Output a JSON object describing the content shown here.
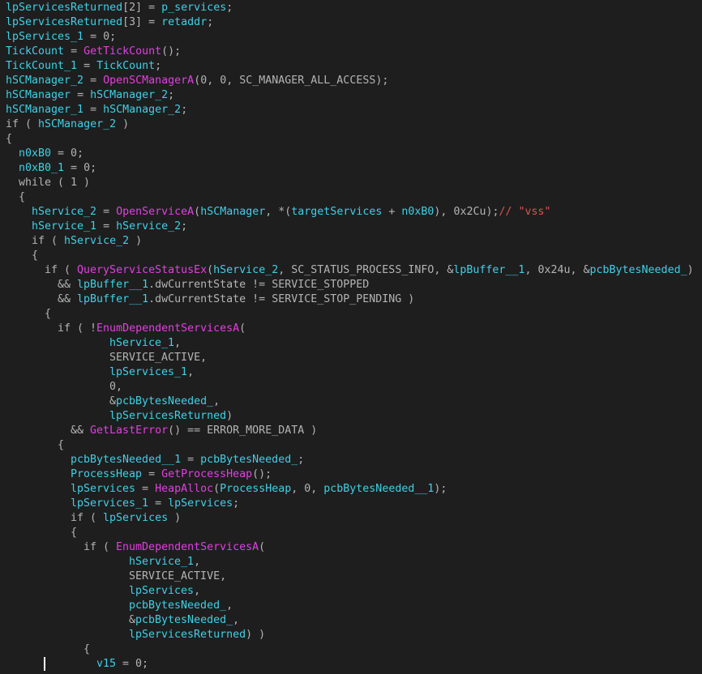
{
  "editor": {
    "lines": [
      {
        "indent": 0,
        "tokens": [
          {
            "t": "lpServicesReturned",
            "c": "var"
          },
          {
            "t": "[2] = ",
            "c": "txt"
          },
          {
            "t": "p_services",
            "c": "var"
          },
          {
            "t": ";",
            "c": "txt"
          }
        ]
      },
      {
        "indent": 0,
        "tokens": [
          {
            "t": "lpServicesReturned",
            "c": "var"
          },
          {
            "t": "[3] = ",
            "c": "txt"
          },
          {
            "t": "retaddr",
            "c": "var"
          },
          {
            "t": ";",
            "c": "txt"
          }
        ]
      },
      {
        "indent": 0,
        "tokens": [
          {
            "t": "lpServices_1",
            "c": "var"
          },
          {
            "t": " = 0;",
            "c": "txt"
          }
        ]
      },
      {
        "indent": 0,
        "tokens": [
          {
            "t": "TickCount",
            "c": "var"
          },
          {
            "t": " = ",
            "c": "txt"
          },
          {
            "t": "GetTickCount",
            "c": "func"
          },
          {
            "t": "();",
            "c": "txt"
          }
        ]
      },
      {
        "indent": 0,
        "tokens": [
          {
            "t": "TickCount_1",
            "c": "var"
          },
          {
            "t": " = ",
            "c": "txt"
          },
          {
            "t": "TickCount",
            "c": "var"
          },
          {
            "t": ";",
            "c": "txt"
          }
        ]
      },
      {
        "indent": 0,
        "tokens": [
          {
            "t": "hSCManager_2",
            "c": "var"
          },
          {
            "t": " = ",
            "c": "txt"
          },
          {
            "t": "OpenSCManagerA",
            "c": "func"
          },
          {
            "t": "(0, 0, SC_MANAGER_ALL_ACCESS);",
            "c": "txt"
          }
        ]
      },
      {
        "indent": 0,
        "tokens": [
          {
            "t": "hSCManager",
            "c": "var"
          },
          {
            "t": " = ",
            "c": "txt"
          },
          {
            "t": "hSCManager_2",
            "c": "var"
          },
          {
            "t": ";",
            "c": "txt"
          }
        ]
      },
      {
        "indent": 0,
        "tokens": [
          {
            "t": "hSCManager_1",
            "c": "var"
          },
          {
            "t": " = ",
            "c": "txt"
          },
          {
            "t": "hSCManager_2",
            "c": "var"
          },
          {
            "t": ";",
            "c": "txt"
          }
        ]
      },
      {
        "indent": 0,
        "tokens": [
          {
            "t": "if ( ",
            "c": "kw"
          },
          {
            "t": "hSCManager_2",
            "c": "var"
          },
          {
            "t": " )",
            "c": "txt"
          }
        ]
      },
      {
        "indent": 0,
        "tokens": [
          {
            "t": "{",
            "c": "txt"
          }
        ]
      },
      {
        "indent": 2,
        "tokens": [
          {
            "t": "n0xB0",
            "c": "var"
          },
          {
            "t": " = 0;",
            "c": "txt"
          }
        ]
      },
      {
        "indent": 2,
        "tokens": [
          {
            "t": "n0xB0_1",
            "c": "var"
          },
          {
            "t": " = 0;",
            "c": "txt"
          }
        ]
      },
      {
        "indent": 2,
        "tokens": [
          {
            "t": "while ( 1 )",
            "c": "kw"
          }
        ]
      },
      {
        "indent": 2,
        "tokens": [
          {
            "t": "{",
            "c": "txt"
          }
        ]
      },
      {
        "indent": 4,
        "tokens": [
          {
            "t": "hService_2",
            "c": "var"
          },
          {
            "t": " = ",
            "c": "txt"
          },
          {
            "t": "OpenServiceA",
            "c": "func"
          },
          {
            "t": "(",
            "c": "txt"
          },
          {
            "t": "hSCManager",
            "c": "var"
          },
          {
            "t": ", *(",
            "c": "txt"
          },
          {
            "t": "targetServices",
            "c": "var"
          },
          {
            "t": " + ",
            "c": "txt"
          },
          {
            "t": "n0xB0",
            "c": "var"
          },
          {
            "t": "), 0x2Cu);",
            "c": "txt"
          },
          {
            "t": "// \"vss\"",
            "c": "cmt"
          }
        ]
      },
      {
        "indent": 4,
        "tokens": [
          {
            "t": "hService_1",
            "c": "var"
          },
          {
            "t": " = ",
            "c": "txt"
          },
          {
            "t": "hService_2",
            "c": "var"
          },
          {
            "t": ";",
            "c": "txt"
          }
        ]
      },
      {
        "indent": 4,
        "tokens": [
          {
            "t": "if ( ",
            "c": "kw"
          },
          {
            "t": "hService_2",
            "c": "var"
          },
          {
            "t": " )",
            "c": "txt"
          }
        ]
      },
      {
        "indent": 4,
        "tokens": [
          {
            "t": "{",
            "c": "txt"
          }
        ]
      },
      {
        "indent": 6,
        "tokens": [
          {
            "t": "if ( ",
            "c": "kw"
          },
          {
            "t": "QueryServiceStatusEx",
            "c": "func"
          },
          {
            "t": "(",
            "c": "txt"
          },
          {
            "t": "hService_2",
            "c": "var"
          },
          {
            "t": ", SC_STATUS_PROCESS_INFO, &",
            "c": "txt"
          },
          {
            "t": "lpBuffer__1",
            "c": "var"
          },
          {
            "t": ", 0x24u, &",
            "c": "txt"
          },
          {
            "t": "pcbBytesNeeded_",
            "c": "var"
          },
          {
            "t": ")",
            "c": "txt"
          }
        ]
      },
      {
        "indent": 8,
        "tokens": [
          {
            "t": "&& ",
            "c": "txt"
          },
          {
            "t": "lpBuffer__1",
            "c": "var"
          },
          {
            "t": ".dwCurrentState != SERVICE_STOPPED",
            "c": "txt"
          }
        ]
      },
      {
        "indent": 8,
        "tokens": [
          {
            "t": "&& ",
            "c": "txt"
          },
          {
            "t": "lpBuffer__1",
            "c": "var"
          },
          {
            "t": ".dwCurrentState != SERVICE_STOP_PENDING )",
            "c": "txt"
          }
        ]
      },
      {
        "indent": 6,
        "tokens": [
          {
            "t": "{",
            "c": "txt"
          }
        ]
      },
      {
        "indent": 8,
        "tokens": [
          {
            "t": "if ( !",
            "c": "kw"
          },
          {
            "t": "EnumDependentServicesA",
            "c": "func"
          },
          {
            "t": "(",
            "c": "txt"
          }
        ]
      },
      {
        "indent": 16,
        "tokens": [
          {
            "t": "hService_1",
            "c": "var"
          },
          {
            "t": ",",
            "c": "txt"
          }
        ]
      },
      {
        "indent": 16,
        "tokens": [
          {
            "t": "SERVICE_ACTIVE,",
            "c": "txt"
          }
        ]
      },
      {
        "indent": 16,
        "tokens": [
          {
            "t": "lpServices_1",
            "c": "var"
          },
          {
            "t": ",",
            "c": "txt"
          }
        ]
      },
      {
        "indent": 16,
        "tokens": [
          {
            "t": "0,",
            "c": "txt"
          }
        ]
      },
      {
        "indent": 16,
        "tokens": [
          {
            "t": "&",
            "c": "txt"
          },
          {
            "t": "pcbBytesNeeded_",
            "c": "var"
          },
          {
            "t": ",",
            "c": "txt"
          }
        ]
      },
      {
        "indent": 16,
        "tokens": [
          {
            "t": "lpServicesReturned",
            "c": "var"
          },
          {
            "t": ")",
            "c": "txt"
          }
        ]
      },
      {
        "indent": 10,
        "tokens": [
          {
            "t": "&& ",
            "c": "txt"
          },
          {
            "t": "GetLastError",
            "c": "func"
          },
          {
            "t": "() == ERROR_MORE_DATA )",
            "c": "txt"
          }
        ]
      },
      {
        "indent": 8,
        "tokens": [
          {
            "t": "{",
            "c": "txt"
          }
        ]
      },
      {
        "indent": 10,
        "tokens": [
          {
            "t": "pcbBytesNeeded__1",
            "c": "var"
          },
          {
            "t": " = ",
            "c": "txt"
          },
          {
            "t": "pcbBytesNeeded_",
            "c": "var"
          },
          {
            "t": ";",
            "c": "txt"
          }
        ]
      },
      {
        "indent": 10,
        "tokens": [
          {
            "t": "ProcessHeap",
            "c": "var"
          },
          {
            "t": " = ",
            "c": "txt"
          },
          {
            "t": "GetProcessHeap",
            "c": "func"
          },
          {
            "t": "();",
            "c": "txt"
          }
        ]
      },
      {
        "indent": 10,
        "tokens": [
          {
            "t": "lpServices",
            "c": "var"
          },
          {
            "t": " = ",
            "c": "txt"
          },
          {
            "t": "HeapAlloc",
            "c": "func"
          },
          {
            "t": "(",
            "c": "txt"
          },
          {
            "t": "ProcessHeap",
            "c": "var"
          },
          {
            "t": ", 0, ",
            "c": "txt"
          },
          {
            "t": "pcbBytesNeeded__1",
            "c": "var"
          },
          {
            "t": ");",
            "c": "txt"
          }
        ]
      },
      {
        "indent": 10,
        "tokens": [
          {
            "t": "lpServices_1",
            "c": "var"
          },
          {
            "t": " = ",
            "c": "txt"
          },
          {
            "t": "lpServices",
            "c": "var"
          },
          {
            "t": ";",
            "c": "txt"
          }
        ]
      },
      {
        "indent": 10,
        "tokens": [
          {
            "t": "if ( ",
            "c": "kw"
          },
          {
            "t": "lpServices",
            "c": "var"
          },
          {
            "t": " )",
            "c": "txt"
          }
        ]
      },
      {
        "indent": 10,
        "tokens": [
          {
            "t": "{",
            "c": "txt"
          }
        ]
      },
      {
        "indent": 12,
        "tokens": [
          {
            "t": "if ( ",
            "c": "kw"
          },
          {
            "t": "EnumDependentServicesA",
            "c": "func"
          },
          {
            "t": "(",
            "c": "txt"
          }
        ]
      },
      {
        "indent": 19,
        "tokens": [
          {
            "t": "hService_1",
            "c": "var"
          },
          {
            "t": ",",
            "c": "txt"
          }
        ]
      },
      {
        "indent": 19,
        "tokens": [
          {
            "t": "SERVICE_ACTIVE,",
            "c": "txt"
          }
        ]
      },
      {
        "indent": 19,
        "tokens": [
          {
            "t": "lpServices",
            "c": "var"
          },
          {
            "t": ",",
            "c": "txt"
          }
        ]
      },
      {
        "indent": 19,
        "tokens": [
          {
            "t": "pcbBytesNeeded_",
            "c": "var"
          },
          {
            "t": ",",
            "c": "txt"
          }
        ]
      },
      {
        "indent": 19,
        "tokens": [
          {
            "t": "&",
            "c": "txt"
          },
          {
            "t": "pcbBytesNeeded_",
            "c": "var"
          },
          {
            "t": ",",
            "c": "txt"
          }
        ]
      },
      {
        "indent": 19,
        "tokens": [
          {
            "t": "lpServicesReturned",
            "c": "var"
          },
          {
            "t": ") )",
            "c": "txt"
          }
        ]
      },
      {
        "indent": 12,
        "tokens": [
          {
            "t": "{",
            "c": "txt"
          }
        ]
      },
      {
        "indent": 14,
        "tokens": [
          {
            "t": "v15",
            "c": "var"
          },
          {
            "t": " = 0;",
            "c": "txt"
          }
        ]
      }
    ]
  }
}
